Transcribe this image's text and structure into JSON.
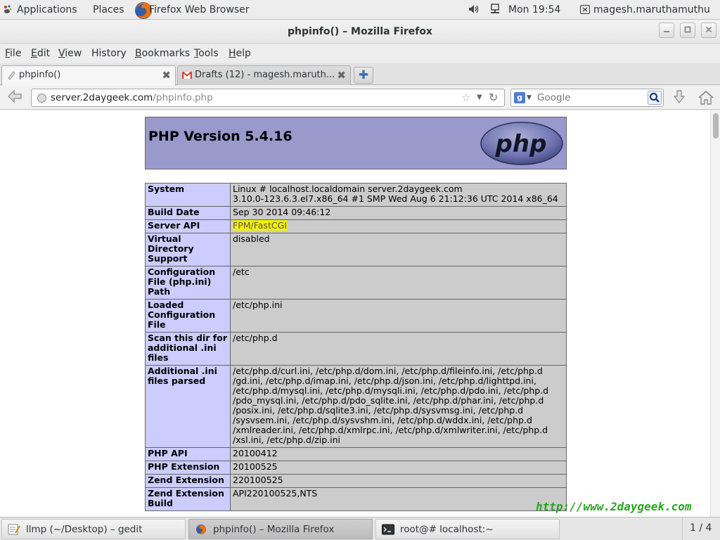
{
  "panel": {
    "applications": "Applications",
    "places": "Places",
    "active_app": "Firefox Web Browser",
    "clock": "Mon 19:54",
    "user": "magesh.maruthamuthu"
  },
  "window": {
    "title": "phpinfo() – Mozilla Firefox"
  },
  "menubar": {
    "items": [
      {
        "label": "File",
        "mnemonic": "F",
        "rest": "ile"
      },
      {
        "label": "Edit",
        "mnemonic": "E",
        "rest": "dit"
      },
      {
        "label": "View",
        "mnemonic": "V",
        "rest": "iew"
      },
      {
        "label": "History",
        "mnemonic": "",
        "rest": "History"
      },
      {
        "label": "Bookmarks",
        "mnemonic": "B",
        "rest": "ookmarks"
      },
      {
        "label": "Tools",
        "mnemonic": "T",
        "rest": "ools"
      },
      {
        "label": "Help",
        "mnemonic": "H",
        "rest": "elp"
      }
    ]
  },
  "tabs": [
    {
      "label": "phpinfo()",
      "active": true
    },
    {
      "label": "Drafts (12) - magesh.maruth...",
      "active": false
    }
  ],
  "navbar": {
    "url_host": "server.2daygeek.com",
    "url_path": "/phpinfo.php",
    "search_placeholder": "Google"
  },
  "php": {
    "version_title": "PHP Version 5.4.16",
    "logo_text": "php"
  },
  "info_rows": [
    {
      "key": "System",
      "value": "Linux # localhost.localdomain server.2daygeek.com\n3.10.0-123.6.3.el7.x86_64 #1 SMP Wed Aug 6 21:12:36 UTC 2014 x86_64"
    },
    {
      "key": "Build Date",
      "value": "Sep 30 2014 09:46:12"
    },
    {
      "key": "Server API",
      "value": "FPM/FastCGI",
      "highlight": true
    },
    {
      "key": "Virtual\nDirectory\nSupport",
      "value": "disabled"
    },
    {
      "key": "Configuration\nFile (php.ini)\nPath",
      "value": "/etc"
    },
    {
      "key": "Loaded\nConfiguration\nFile",
      "value": "/etc/php.ini"
    },
    {
      "key": "Scan this dir for\nadditional .ini\nfiles",
      "value": "/etc/php.d"
    },
    {
      "key": "Additional .ini\nfiles parsed",
      "value": "/etc/php.d/curl.ini, /etc/php.d/dom.ini, /etc/php.d/fileinfo.ini, /etc/php.d\n/gd.ini, /etc/php.d/imap.ini, /etc/php.d/json.ini, /etc/php.d/lighttpd.ini,\n/etc/php.d/mysql.ini, /etc/php.d/mysqli.ini, /etc/php.d/pdo.ini, /etc/php.d\n/pdo_mysql.ini, /etc/php.d/pdo_sqlite.ini, /etc/php.d/phar.ini, /etc/php.d\n/posix.ini, /etc/php.d/sqlite3.ini, /etc/php.d/sysvmsg.ini, /etc/php.d\n/sysvsem.ini, /etc/php.d/sysvshm.ini, /etc/php.d/wddx.ini, /etc/php.d\n/xmlreader.ini, /etc/php.d/xmlrpc.ini, /etc/php.d/xmlwriter.ini, /etc/php.d\n/xsl.ini, /etc/php.d/zip.ini"
    },
    {
      "key": "PHP API",
      "value": "20100412"
    },
    {
      "key": "PHP Extension",
      "value": "20100525"
    },
    {
      "key": "Zend Extension",
      "value": "220100525"
    },
    {
      "key": "Zend Extension\nBuild",
      "value": "API220100525,NTS"
    }
  ],
  "watermark": "http://www.2daygeek.com",
  "taskbar": {
    "tasks": [
      {
        "label": "llmp (~/Desktop) – gedit",
        "icon": "gedit-icon"
      },
      {
        "label": "phpinfo() – Mozilla Firefox",
        "icon": "firefox-icon",
        "active": true
      },
      {
        "label": "root@# localhost:~",
        "icon": "terminal-icon"
      }
    ],
    "workspace": "1 / 4"
  },
  "colors": {
    "php_header_bg": "#9999cc",
    "key_cell_bg": "#ccccff",
    "value_cell_bg": "#cccccc",
    "highlight": "#f4f000",
    "watermark": "#2aa520"
  }
}
